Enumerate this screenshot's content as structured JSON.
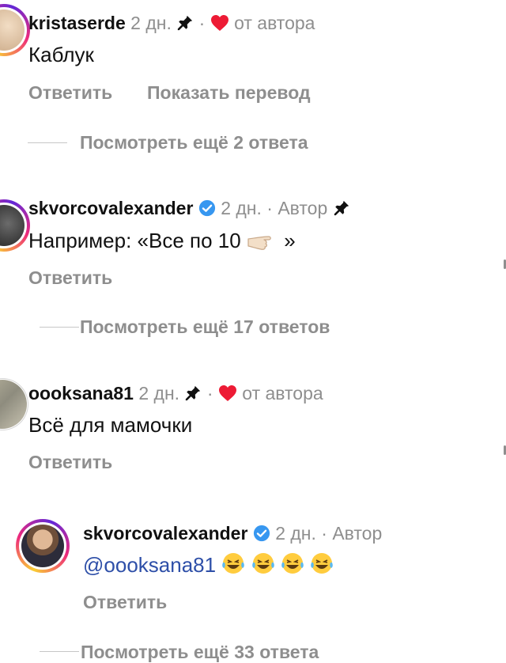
{
  "comments": [
    {
      "username": "kristaserde",
      "time": "2 дн.",
      "sep": "·",
      "liked_by_author": "от автора",
      "text": "Каблук",
      "reply_label": "Ответить",
      "translate_label": "Показать перевод",
      "more_replies": "Посмотреть ещё 2 ответа"
    },
    {
      "username": "skvorcovalexander",
      "time": "2 дн.",
      "sep": "·",
      "author_label": "Автор",
      "text_before": "Например: «Все по 10",
      "text_after": "»",
      "reply_label": "Ответить",
      "more_replies": "Посмотреть ещё 17 ответов"
    },
    {
      "username": "oooksana81",
      "time": "2 дн.",
      "sep": "·",
      "liked_by_author": "от автора",
      "text": "Всё для мамочки",
      "reply_label": "Ответить"
    }
  ],
  "reply": {
    "username": "skvorcovalexander",
    "time": "2 дн.",
    "sep": "·",
    "author_label": "Автор",
    "mention": "@oooksana81",
    "emoji_count": 4,
    "reply_label": "Ответить",
    "more_replies": "Посмотреть ещё 33 ответа"
  },
  "colors": {
    "secondary_text": "#8e8e8e",
    "heart": "#ed1b35",
    "verified": "#3797f0",
    "mention": "#2e4fa8"
  },
  "icons": [
    "pin-icon",
    "heart-icon",
    "verified-badge-icon",
    "pointing-hand-emoji",
    "laughing-tears-emoji"
  ]
}
